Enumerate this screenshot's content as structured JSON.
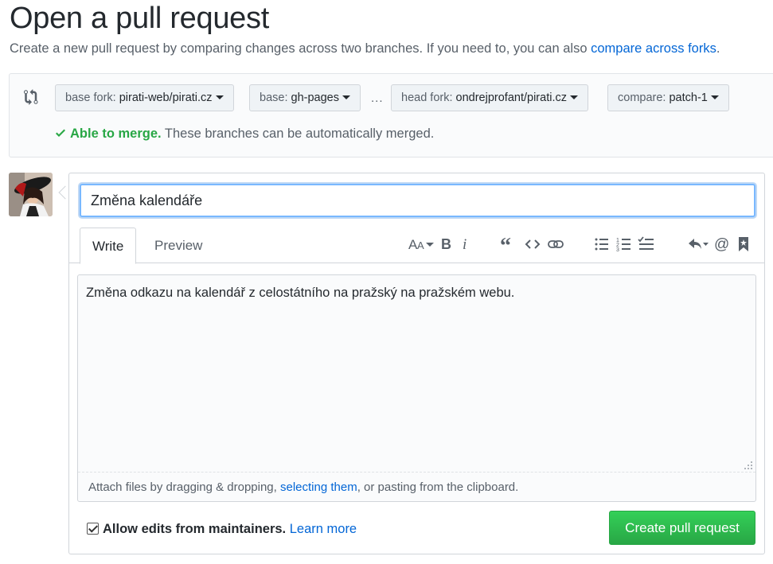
{
  "page": {
    "title": "Open a pull request",
    "subtitle": "Create a new pull request by comparing changes across two branches. If you need to, you can also",
    "subtitle_link": "compare across forks",
    "subtitle_end": "."
  },
  "range": {
    "base_fork_label": "base fork:",
    "base_fork_value": "pirati-web/pirati.cz",
    "base_label": "base:",
    "base_value": "gh-pages",
    "separator": "...",
    "head_fork_label": "head fork:",
    "head_fork_value": "ondrejprofant/pirati.cz",
    "compare_label": "compare:",
    "compare_value": "patch-1",
    "merge_ok": "Able to merge.",
    "merge_text": "These branches can be automatically merged."
  },
  "form": {
    "title_value": "Změna kalendáře",
    "tabs": [
      {
        "label": "Write"
      },
      {
        "label": "Preview"
      }
    ],
    "toolbar_icons": [
      "text-size-icon",
      "bold-icon",
      "italic-icon",
      "quote-icon",
      "code-icon",
      "link-icon",
      "unordered-list-icon",
      "ordered-list-icon",
      "task-list-icon",
      "reply-icon",
      "mention-icon",
      "bookmark-icon"
    ],
    "body_text": "Změna odkazu na kalendář z celostátního na pražský na pražském webu.",
    "attach_prefix": "Attach files by dragging & dropping,",
    "attach_link": "selecting them",
    "attach_suffix": ", or pasting from the clipboard.",
    "allow_label": "Allow edits from maintainers.",
    "allow_checked": true,
    "learn_more": "Learn more",
    "submit_label": "Create pull request"
  },
  "colors": {
    "link": "#0366d6",
    "success": "#28a745",
    "text": "#24292e",
    "muted": "#586069"
  }
}
